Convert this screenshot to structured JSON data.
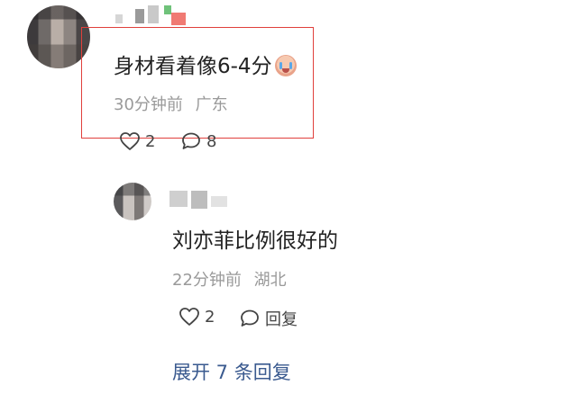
{
  "main_comment": {
    "text": "身材看着像6-4分",
    "time": "30分钟前",
    "location": "广东",
    "likes": "2",
    "replies": "8",
    "emoji_icon": "crying-face-icon"
  },
  "reply": {
    "text": "刘亦菲比例很好的",
    "time": "22分钟前",
    "location": "湖北",
    "likes": "2",
    "reply_label": "回复"
  },
  "expand_replies_label": "展开 7 条回复",
  "colors": {
    "highlight_border": "#e0403c",
    "link": "#3a5a8f",
    "meta_text": "#9a9a9a"
  }
}
